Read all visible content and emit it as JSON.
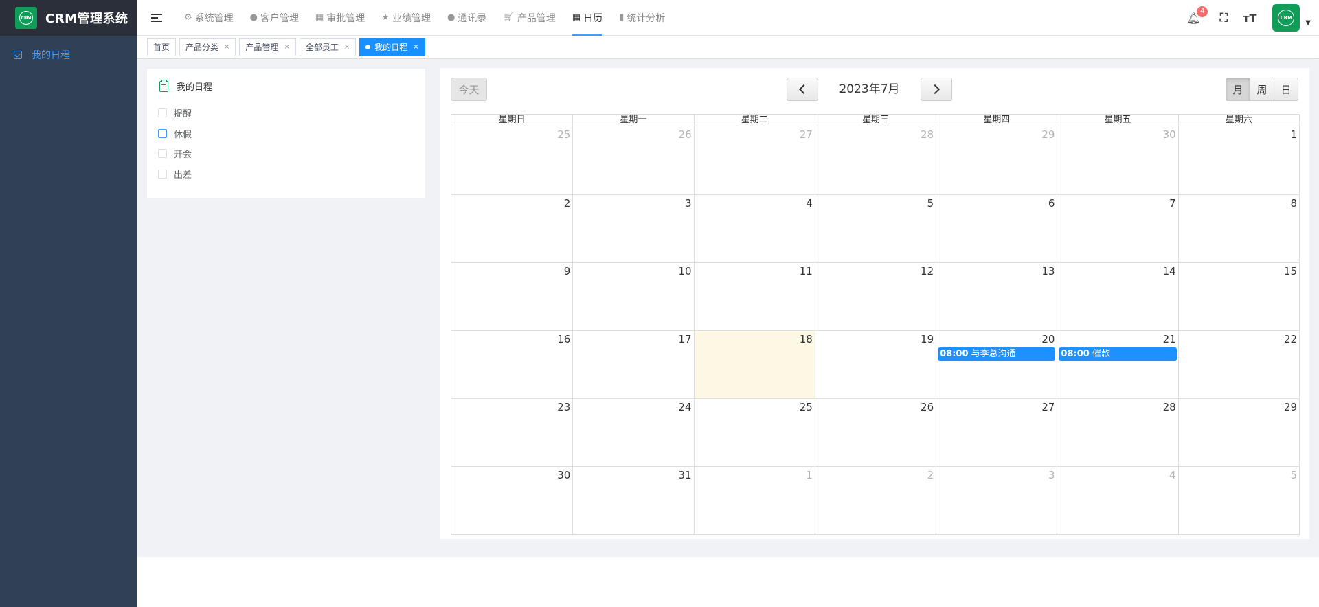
{
  "app": {
    "title": "CRM管理系统",
    "logo_text": "CRM"
  },
  "sidebar": {
    "items": [
      {
        "label": "我的日程",
        "icon": "check-square-icon"
      }
    ]
  },
  "navbar": {
    "menu": [
      {
        "label": "系统管理",
        "icon": "gear-icon"
      },
      {
        "label": "客户管理",
        "icon": "user-icon"
      },
      {
        "label": "审批管理",
        "icon": "table-icon"
      },
      {
        "label": "业绩管理",
        "icon": "star-icon"
      },
      {
        "label": "通讯录",
        "icon": "person-icon"
      },
      {
        "label": "产品管理",
        "icon": "cart-icon"
      },
      {
        "label": "日历",
        "icon": "calendar-icon"
      },
      {
        "label": "统计分析",
        "icon": "bar-chart-icon"
      }
    ],
    "active_index": 6,
    "notification_count": "4"
  },
  "tags": [
    {
      "label": "首页"
    },
    {
      "label": "产品分类"
    },
    {
      "label": "产品管理"
    },
    {
      "label": "全部员工"
    },
    {
      "label": "我的日程"
    }
  ],
  "schedule_panel": {
    "title": "我的日程",
    "filters": [
      "提醒",
      "休假",
      "开会",
      "出差"
    ]
  },
  "calendar": {
    "today_label": "今天",
    "title": "2023年7月",
    "views": [
      "月",
      "周",
      "日"
    ],
    "weekdays": [
      "星期日",
      "星期一",
      "星期二",
      "星期三",
      "星期四",
      "星期五",
      "星期六"
    ],
    "weeks": [
      [
        "25",
        "26",
        "27",
        "28",
        "29",
        "30",
        "1"
      ],
      [
        "2",
        "3",
        "4",
        "5",
        "6",
        "7",
        "8"
      ],
      [
        "9",
        "10",
        "11",
        "12",
        "13",
        "14",
        "15"
      ],
      [
        "16",
        "17",
        "18",
        "19",
        "20",
        "21",
        "22"
      ],
      [
        "23",
        "24",
        "25",
        "26",
        "27",
        "28",
        "29"
      ],
      [
        "30",
        "31",
        "1",
        "2",
        "3",
        "4",
        "5"
      ]
    ],
    "events": [
      {
        "date": "20",
        "time": "08:00",
        "title": "与李总沟通"
      },
      {
        "date": "21",
        "time": "08:00",
        "title": "催款"
      }
    ],
    "highlight_color": "#fcf8e3",
    "event_color": "#1e90ff"
  }
}
